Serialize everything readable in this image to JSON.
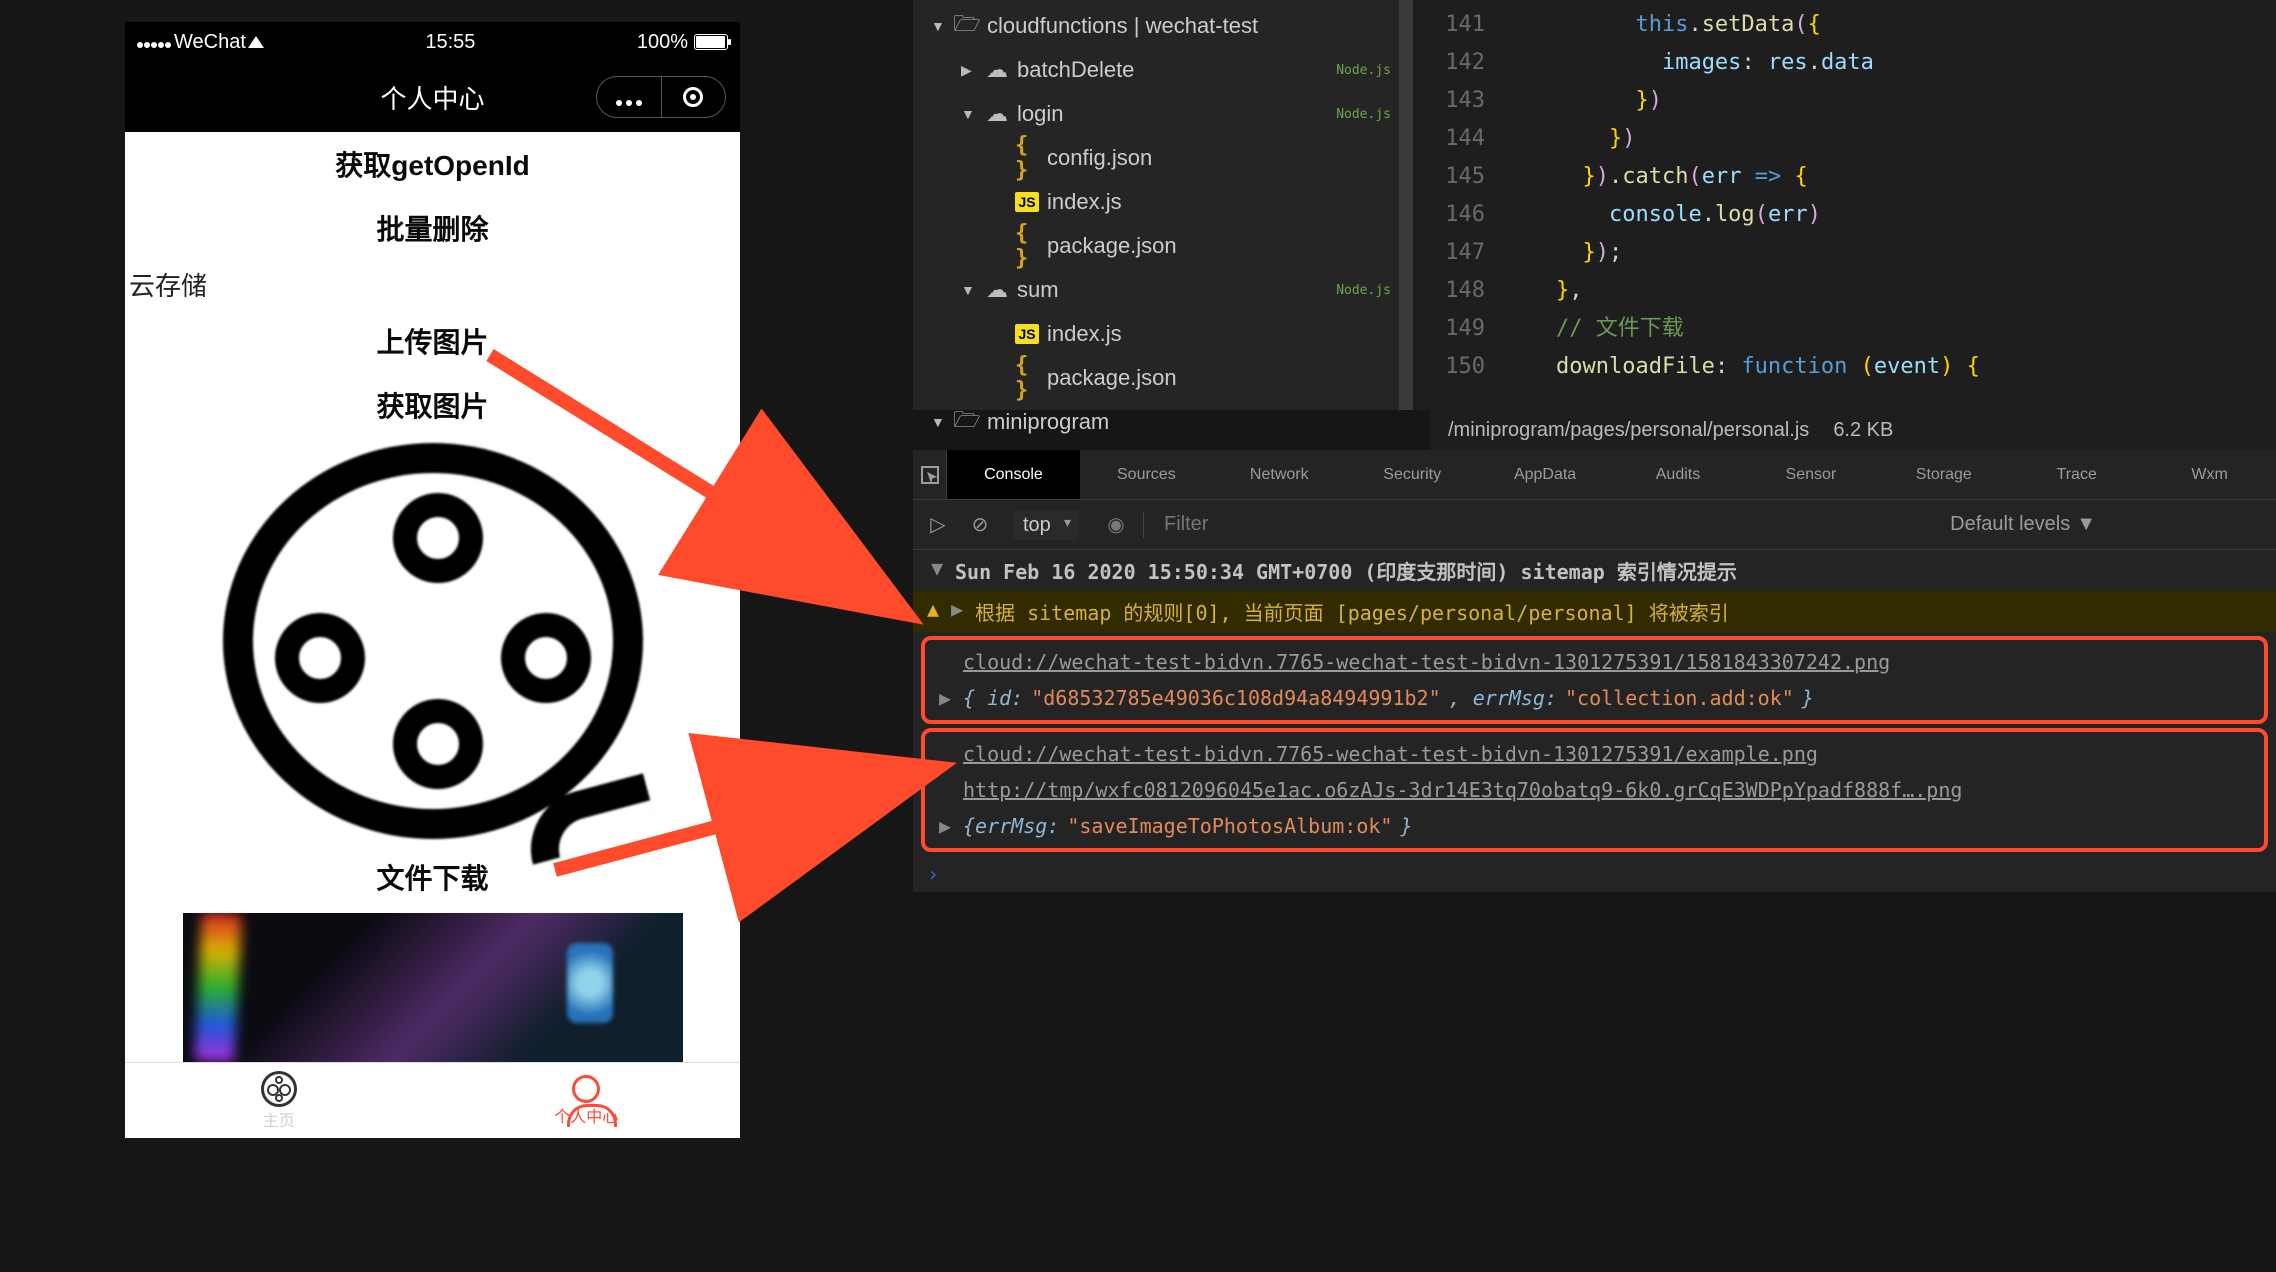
{
  "phone": {
    "carrier": "WeChat",
    "time": "15:55",
    "battery": "100%",
    "title": "个人中心",
    "sections": {
      "getOpenId": "获取getOpenId",
      "batchDelete": "批量删除",
      "cloudStorage": "云存储",
      "upload": "上传图片",
      "fetch": "获取图片",
      "download": "文件下载"
    },
    "tabs": {
      "home": "主页",
      "personal": "个人中心"
    }
  },
  "explorer": {
    "root": "cloudfunctions | wechat-test",
    "batchDelete": "batchDelete",
    "login": "login",
    "loginFiles": [
      "config.json",
      "index.js",
      "package.json"
    ],
    "sum": "sum",
    "sumFiles": [
      "index.js",
      "package.json"
    ],
    "miniprogram": "miniprogram",
    "nodeBadge": "Node.js"
  },
  "code": {
    "lines": [
      "141",
      "142",
      "143",
      "144",
      "145",
      "146",
      "147",
      "148",
      "149",
      "150"
    ],
    "l142_prop": "images",
    "l142_rhs": "res",
    "l142_rhs2": "data",
    "l145_fn": "catch",
    "l145_arg": "err",
    "l146_fn": "log",
    "l146_call": "console",
    "l146_arg": "err",
    "l149_comment": "// 文件下载",
    "l150_name": "downloadFile",
    "l150_kw": "function",
    "l150_arg": "event",
    "l141_this": "this",
    "l141_fn": "setData"
  },
  "editorStatus": {
    "path": "/miniprogram/pages/personal/personal.js",
    "size": "6.2 KB"
  },
  "devtools": {
    "tabs": [
      "Console",
      "Sources",
      "Network",
      "Security",
      "AppData",
      "Audits",
      "Sensor",
      "Storage",
      "Trace",
      "Wxm"
    ],
    "context": "top",
    "filterPlaceholder": "Filter",
    "levels": "Default levels",
    "sitemapLine": "Sun Feb 16 2020 15:50:34 GMT+0700 (印度支那时间) sitemap 索引情况提示",
    "warnLine": "根据 sitemap 的规则[0], 当前页面 [pages/personal/personal] 将被索引",
    "box1": {
      "link": "cloud://wechat-test-bidvn.7765-wechat-test-bidvn-1301275391/1581843307242.png",
      "objPre": "{ id: ",
      "objId": "\"d68532785e49036c108d94a8494991b2\"",
      "objMid": ", errMsg: ",
      "objMsg": "\"collection.add:ok\"",
      "objEnd": "}"
    },
    "box2": {
      "link1": "cloud://wechat-test-bidvn.7765-wechat-test-bidvn-1301275391/example.png",
      "link2": "http://tmp/wxfc0812096045e1ac.o6zAJs-3dr14E3tq70obatq9-6k0.grCqE3WDPpYpadf888f….png",
      "objPre": "{errMsg: ",
      "objMsg": "\"saveImageToPhotosAlbum:ok\"",
      "objEnd": "}"
    }
  }
}
